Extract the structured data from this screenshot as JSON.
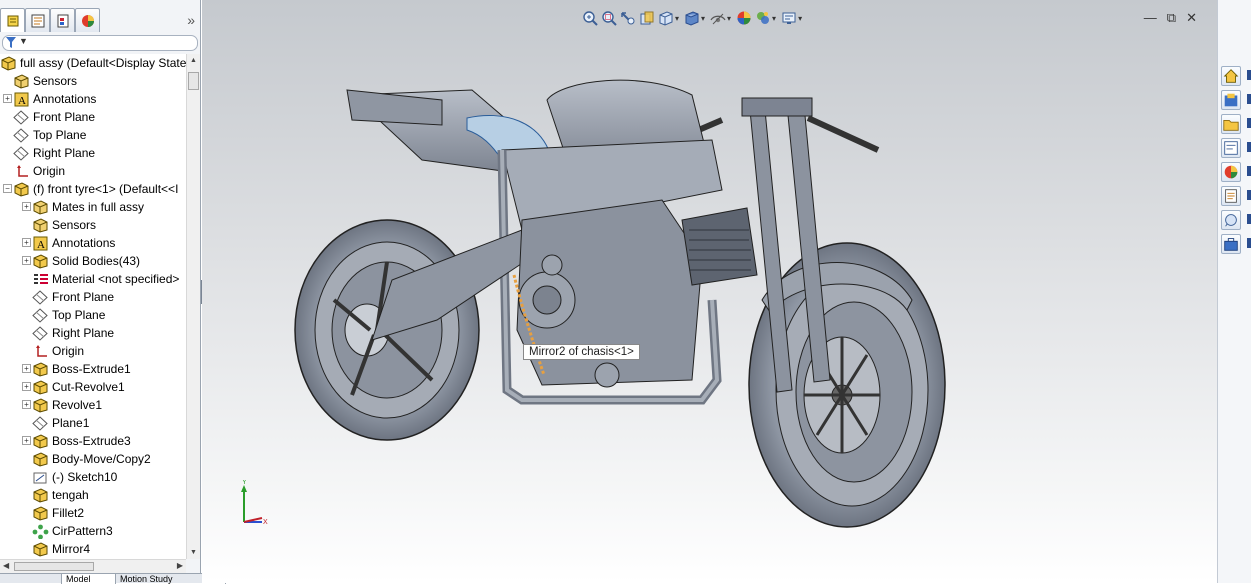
{
  "feature_manager": {
    "collapse_glyph": "»",
    "tabs": [
      {
        "icon": "feature-manager-tree-icon"
      },
      {
        "icon": "property-manager-icon"
      },
      {
        "icon": "configuration-manager-icon"
      },
      {
        "icon": "display-manager-icon"
      }
    ],
    "filter": {
      "icon": "filter-icon",
      "caret": "▼"
    },
    "tree": [
      {
        "level": 0,
        "icon": "assembly-icon",
        "label": "full assy  (Default<Display State-",
        "expand": ""
      },
      {
        "level": 1,
        "icon": "sensors-icon",
        "label": "Sensors",
        "expand": ""
      },
      {
        "level": 1,
        "icon": "annotations-icon",
        "label": "Annotations",
        "expand": "+"
      },
      {
        "level": 1,
        "icon": "plane-icon",
        "label": "Front Plane",
        "expand": ""
      },
      {
        "level": 1,
        "icon": "plane-icon",
        "label": "Top Plane",
        "expand": ""
      },
      {
        "level": 1,
        "icon": "plane-icon",
        "label": "Right Plane",
        "expand": ""
      },
      {
        "level": 1,
        "icon": "origin-icon",
        "label": "Origin",
        "expand": ""
      },
      {
        "level": 1,
        "icon": "part-icon",
        "label": "(f) front tyre<1> (Default<<I",
        "expand": "−"
      },
      {
        "level": 2,
        "icon": "mates-icon",
        "label": "Mates in full assy",
        "expand": "+"
      },
      {
        "level": 2,
        "icon": "sensors-icon",
        "label": "Sensors",
        "expand": ""
      },
      {
        "level": 2,
        "icon": "annotations-icon",
        "label": "Annotations",
        "expand": "+"
      },
      {
        "level": 2,
        "icon": "solid-bodies-icon",
        "label": "Solid Bodies(43)",
        "expand": "+"
      },
      {
        "level": 2,
        "icon": "material-icon",
        "label": "Material <not specified>",
        "expand": ""
      },
      {
        "level": 2,
        "icon": "plane-icon",
        "label": "Front Plane",
        "expand": ""
      },
      {
        "level": 2,
        "icon": "plane-icon",
        "label": "Top Plane",
        "expand": ""
      },
      {
        "level": 2,
        "icon": "plane-icon",
        "label": "Right Plane",
        "expand": ""
      },
      {
        "level": 2,
        "icon": "origin-icon",
        "label": "Origin",
        "expand": ""
      },
      {
        "level": 2,
        "icon": "boss-extrude-icon",
        "label": "Boss-Extrude1",
        "expand": "+"
      },
      {
        "level": 2,
        "icon": "cut-revolve-icon",
        "label": "Cut-Revolve1",
        "expand": "+"
      },
      {
        "level": 2,
        "icon": "revolve-icon",
        "label": "Revolve1",
        "expand": "+"
      },
      {
        "level": 2,
        "icon": "plane-icon",
        "label": "Plane1",
        "expand": ""
      },
      {
        "level": 2,
        "icon": "boss-extrude-icon",
        "label": "Boss-Extrude3",
        "expand": "+"
      },
      {
        "level": 2,
        "icon": "body-move-icon",
        "label": "Body-Move/Copy2",
        "expand": ""
      },
      {
        "level": 2,
        "icon": "sketch-icon",
        "label": "(-) Sketch10",
        "expand": ""
      },
      {
        "level": 2,
        "icon": "tengah-feature-icon",
        "label": "tengah",
        "expand": ""
      },
      {
        "level": 2,
        "icon": "fillet-icon",
        "label": "Fillet2",
        "expand": ""
      },
      {
        "level": 2,
        "icon": "circular-pattern-icon",
        "label": "CirPattern3",
        "expand": ""
      },
      {
        "level": 2,
        "icon": "mirror-icon",
        "label": "Mirror4",
        "expand": ""
      }
    ],
    "bottom_tabs": [
      "",
      "Model",
      "Motion Study"
    ]
  },
  "viewport": {
    "toolbar": [
      {
        "icon": "zoom-to-fit-icon",
        "dropdown": false
      },
      {
        "icon": "zoom-to-area-icon",
        "dropdown": false
      },
      {
        "icon": "previous-view-icon",
        "dropdown": false
      },
      {
        "icon": "section-view-icon",
        "dropdown": false
      },
      {
        "icon": "view-orientation-icon",
        "dropdown": true
      },
      {
        "icon": "display-style-icon",
        "dropdown": true
      },
      {
        "icon": "hide-show-items-icon",
        "dropdown": true
      },
      {
        "icon": "edit-appearance-icon",
        "dropdown": false
      },
      {
        "icon": "apply-scene-icon",
        "dropdown": true
      },
      {
        "icon": "view-settings-icon",
        "dropdown": true
      }
    ],
    "window_controls": [
      "—",
      "⧉",
      "✕"
    ],
    "tooltip": "Mirror2 of chasis<1>",
    "triad": {
      "y_label": "Y",
      "x_label": "X"
    },
    "model": {
      "name": "motorcycle-assembly"
    }
  },
  "task_pane": {
    "buttons": [
      {
        "icon": "solidworks-resources-icon"
      },
      {
        "icon": "design-library-icon"
      },
      {
        "icon": "file-explorer-icon"
      },
      {
        "icon": "view-palette-icon"
      },
      {
        "icon": "appearances-scenes-icon"
      },
      {
        "icon": "custom-properties-icon"
      },
      {
        "icon": "solidworks-forum-icon"
      },
      {
        "icon": "toolbox-icon"
      }
    ]
  },
  "colors": {
    "selection_highlight": "#e8a040",
    "model_body": "#9aa1ad",
    "tree_selection": "#2a4d8f"
  }
}
